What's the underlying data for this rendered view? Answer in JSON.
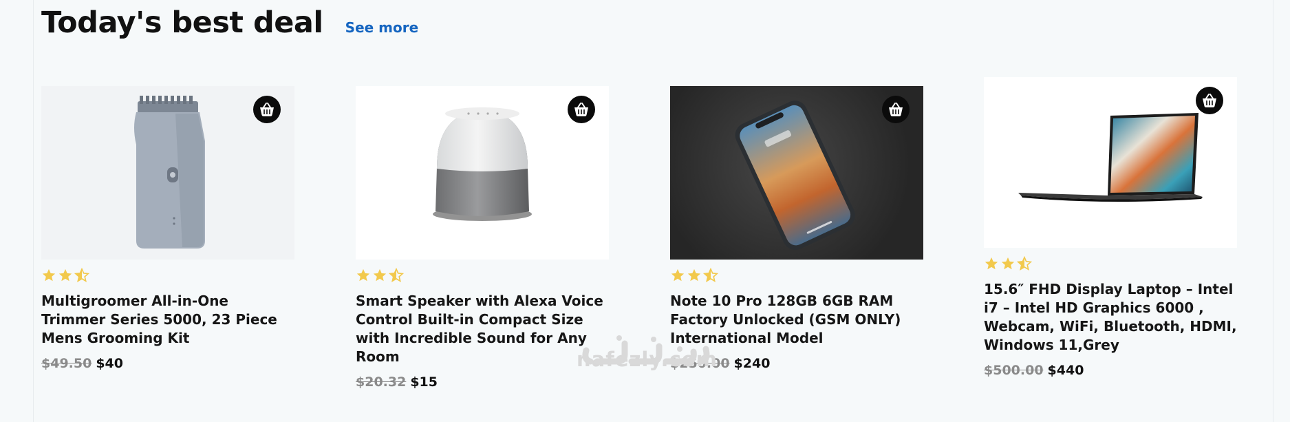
{
  "section": {
    "title": "Today's best deal",
    "see_more_label": "See more"
  },
  "products": [
    {
      "name": "Multigroomer All-in-One Trimmer Series 5000, 23 Piece Mens Grooming Kit",
      "old_price": "$49.50",
      "new_price": "$40",
      "rating": 2.5
    },
    {
      "name": "Smart Speaker with Alexa Voice Control Built-in Compact Size with Incredible Sound for Any Room",
      "old_price": "$20.32",
      "new_price": "$15",
      "rating": 2.5
    },
    {
      "name": "Note 10 Pro 128GB 6GB RAM Factory Unlocked (GSM ONLY) International Model",
      "old_price": "$250.00",
      "new_price": "$240",
      "rating": 2.5
    },
    {
      "name": "15.6″ FHD Display Laptop – Intel i7 – Intel HD Graphics 6000 , Webcam, WiFi, Bluetooth, HDMI, Windows 11,Grey",
      "old_price": "$500.00",
      "new_price": "$440",
      "rating": 2.5
    }
  ],
  "watermark": {
    "text": "nafezly.com"
  },
  "colors": {
    "accent": "#1565c0",
    "star": "#f2c94c",
    "cart_button": "#0b0b0b"
  },
  "icons": {
    "cart": "basket-icon",
    "star": "star-icon",
    "half_star": "half-star-icon"
  }
}
